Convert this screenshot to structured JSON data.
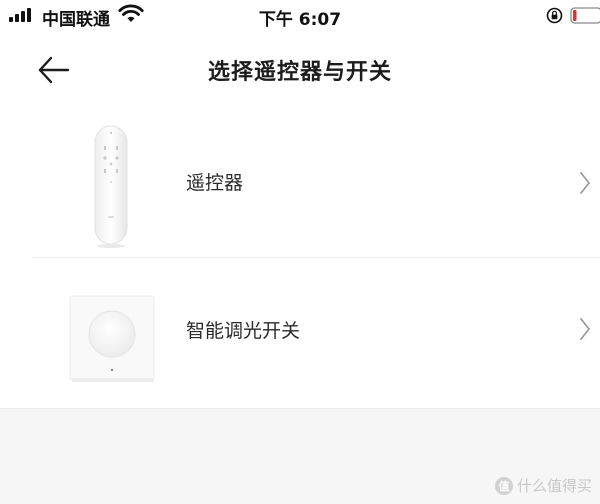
{
  "status_bar": {
    "carrier": "中国联通",
    "time": "下午 6:07",
    "battery_level": 0.1,
    "battery_color": "#e0322f"
  },
  "header": {
    "title": "选择遥控器与开关",
    "back_icon": "arrow-left-icon"
  },
  "devices": [
    {
      "label": "遥控器",
      "image": "remote-control-image",
      "chevron_icon": "chevron-right-icon"
    },
    {
      "label": "智能调光开关",
      "image": "dimmer-switch-image",
      "chevron_icon": "chevron-right-icon"
    }
  ],
  "watermark": {
    "text": "什么值得买"
  },
  "colors": {
    "text_primary": "#1c1c1c",
    "divider": "#ececec",
    "chevron": "#9a9a9a",
    "background_bottom": "#f6f6f6"
  }
}
